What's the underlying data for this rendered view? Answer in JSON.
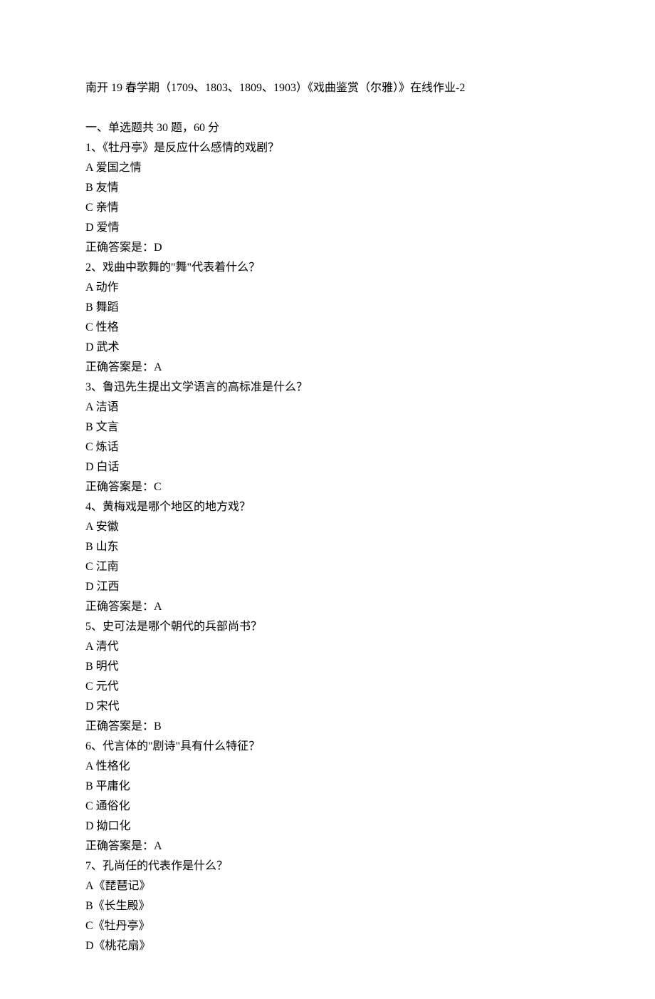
{
  "title": "南开 19 春学期（1709、1803、1809、1903）《戏曲鉴赏（尔雅）》在线作业-2",
  "section_header": "一、单选题共 30 题，60 分",
  "questions": [
    {
      "number": "1、",
      "text": "《牡丹亭》是反应什么感情的戏剧？",
      "options": [
        "A 爱国之情",
        "B 友情",
        "C 亲情",
        "D 爱情"
      ],
      "answer": "正确答案是：D"
    },
    {
      "number": "2、",
      "text": "戏曲中歌舞的\"舞\"代表着什么？",
      "options": [
        "A 动作",
        "B 舞蹈",
        "C 性格",
        "D 武术"
      ],
      "answer": "正确答案是：A"
    },
    {
      "number": "3、",
      "text": "鲁迅先生提出文学语言的高标准是什么？",
      "options": [
        "A 洁语",
        "B 文言",
        "C 炼话",
        "D 白话"
      ],
      "answer": "正确答案是：C"
    },
    {
      "number": "4、",
      "text": "黄梅戏是哪个地区的地方戏？",
      "options": [
        "A 安徽",
        "B 山东",
        "C 江南",
        "D 江西"
      ],
      "answer": "正确答案是：A"
    },
    {
      "number": "5、",
      "text": "史可法是哪个朝代的兵部尚书？",
      "options": [
        "A 清代",
        "B 明代",
        "C 元代",
        "D 宋代"
      ],
      "answer": "正确答案是：B"
    },
    {
      "number": "6、",
      "text": "代言体的\"剧诗\"具有什么特征？",
      "options": [
        "A 性格化",
        "B 平庸化",
        "C 通俗化",
        "D 拗口化"
      ],
      "answer": "正确答案是：A"
    },
    {
      "number": "7、",
      "text": "孔尚任的代表作是什么？",
      "options": [
        "A《琵琶记》",
        "B《长生殿》",
        "C《牡丹亭》",
        "D《桃花扇》"
      ],
      "answer": ""
    }
  ]
}
